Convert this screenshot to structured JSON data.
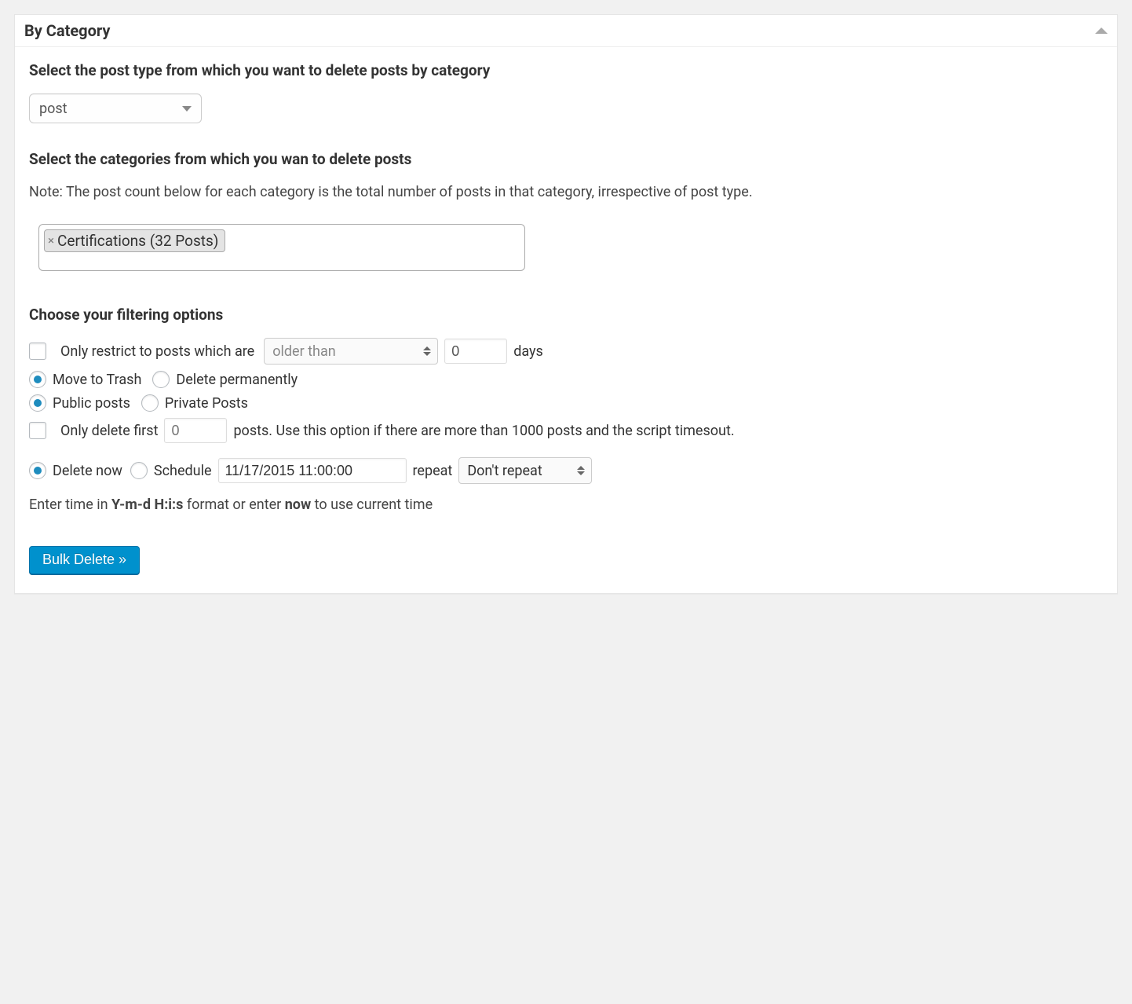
{
  "panel": {
    "title": "By Category"
  },
  "post_type": {
    "heading": "Select the post type from which you want to delete posts by category",
    "selected": "post"
  },
  "categories": {
    "heading": "Select the categories from which you wan to delete posts",
    "note": "Note: The post count below for each category is the total number of posts in that category, irrespective of post type.",
    "selected_tag": "Certifications (32 Posts)"
  },
  "filtering": {
    "heading": "Choose your filtering options",
    "restrict_label": "Only restrict to posts which are",
    "restrict_select": "older than",
    "restrict_days_value": "0",
    "restrict_days_suffix": "days",
    "move_to_trash": "Move to Trash",
    "delete_permanently": "Delete permanently",
    "public_posts": "Public posts",
    "private_posts": "Private Posts",
    "only_delete_first": "Only delete first",
    "only_delete_first_value": "0",
    "only_delete_first_suffix": "posts. Use this option if there are more than 1000 posts and the script timesout.",
    "delete_now": "Delete now",
    "schedule": "Schedule",
    "schedule_value": "11/17/2015 11:00:00",
    "repeat_label": "repeat",
    "repeat_value": "Don't repeat",
    "hint_prefix": "Enter time in ",
    "hint_format": "Y-m-d H:i:s",
    "hint_mid": " format or enter ",
    "hint_now": "now",
    "hint_suffix": " to use current time"
  },
  "button": {
    "label": "Bulk Delete »"
  }
}
